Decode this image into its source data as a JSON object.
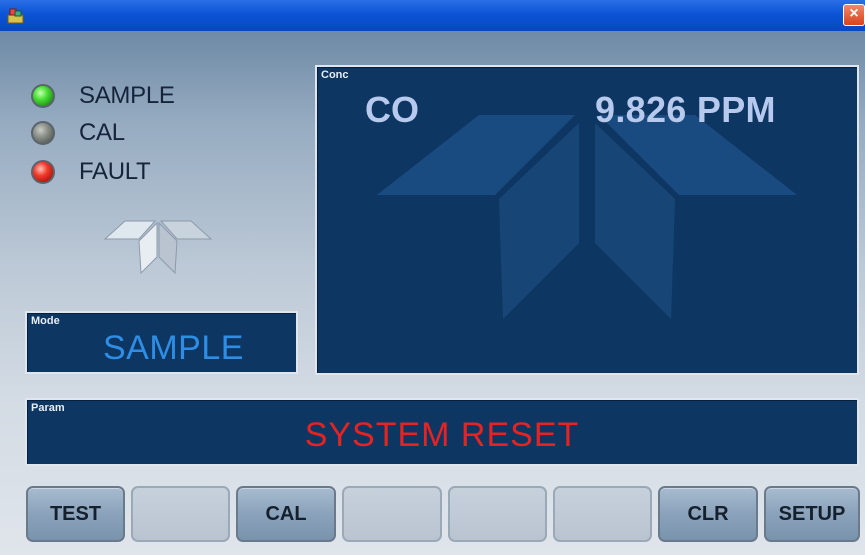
{
  "window": {
    "title": "",
    "icon": "app-window-icon",
    "close_label": "×"
  },
  "status": {
    "leds": [
      {
        "label": "SAMPLE",
        "state": "on",
        "color": "#3fd12c"
      },
      {
        "label": "CAL",
        "state": "off",
        "color": "#7b8079"
      },
      {
        "label": "FAULT",
        "state": "on",
        "color": "#e8281c"
      }
    ]
  },
  "logo": {
    "icon": "teledyne-logo-icon"
  },
  "conc": {
    "label": "Conc",
    "gas": "CO",
    "value": "9.826 PPM"
  },
  "mode": {
    "label": "Mode",
    "value": "SAMPLE"
  },
  "param": {
    "label": "Param",
    "value": "SYSTEM RESET"
  },
  "buttons": [
    {
      "label": "TEST"
    },
    {
      "label": ""
    },
    {
      "label": "CAL"
    },
    {
      "label": ""
    },
    {
      "label": ""
    },
    {
      "label": ""
    },
    {
      "label": "CLR"
    },
    {
      "label": "SETUP"
    }
  ],
  "colors": {
    "panel": "#0d3663",
    "mode_text": "#2e8de4",
    "conc_text": "#b7c9ec",
    "param_text": "#e62222",
    "titlebar": "#0b54d6"
  }
}
